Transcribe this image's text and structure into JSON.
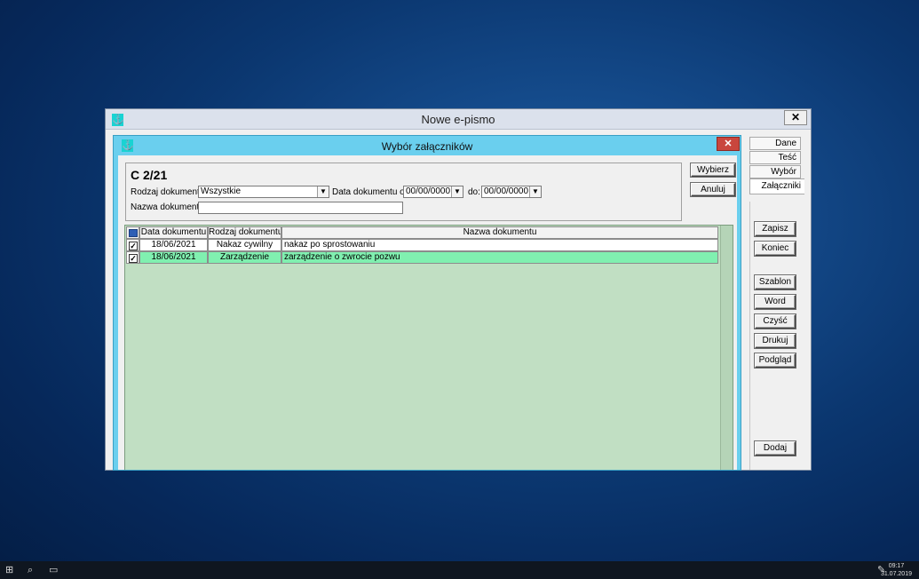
{
  "outer_window": {
    "title": "Nowe e-pismo",
    "close_label": "✕",
    "tabs": [
      "Dane",
      "Teść",
      "Wybór",
      "Załączniki"
    ],
    "active_tab": "Załączniki",
    "buttons": [
      "Zapisz",
      "Koniec",
      "Szablon",
      "Word",
      "Czyść",
      "Drukuj",
      "Podgląd",
      "Dodaj"
    ]
  },
  "dialog": {
    "title": "Wybór załączników",
    "close_label": "✕",
    "case_number": "C 2/21",
    "filters": {
      "doc_type_label": "Rodzaj dokumentu:",
      "doc_type_value": "Wszystkie",
      "date_from_label": "Data dokumentu od:",
      "date_from_value": "00/00/0000",
      "date_to_label": "do:",
      "date_to_value": "00/00/0000",
      "doc_name_label": "Nazwa dokumentu:",
      "doc_name_value": ""
    },
    "buttons": {
      "select": "Wybierz",
      "cancel": "Anuluj"
    },
    "table": {
      "columns": [
        "Data dokumentu",
        "Rodzaj dokumentu",
        "Nazwa dokumentu"
      ],
      "rows": [
        {
          "checked": true,
          "date": "18/06/2021",
          "type": "Nakaz cywilny",
          "name": "nakaz po sprostowaniu",
          "selected": false
        },
        {
          "checked": true,
          "date": "18/06/2021",
          "type": "Zarządzenie",
          "name": "zarządzenie o zwrocie  pozwu",
          "selected": true
        }
      ]
    }
  },
  "taskbar": {
    "time": "09:17",
    "date": "31.07.2019"
  },
  "colors": {
    "dialog_frame": "#6acfee",
    "grid_background": "#c1dfc3",
    "selected_row": "#80f0b0",
    "close_button": "#c9463d"
  }
}
